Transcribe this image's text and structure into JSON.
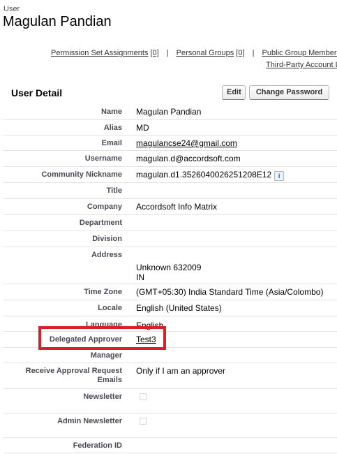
{
  "header": {
    "object_label": "User",
    "title": "Magulan Pandian"
  },
  "related_links": {
    "row1": [
      {
        "label": "Permission Set Assignments",
        "count": "[0]"
      },
      {
        "label": "Personal Groups",
        "count": "[0]"
      },
      {
        "label": "Public Group Membership",
        "count": ""
      }
    ],
    "row2": [
      {
        "label": "Third-Party Account L",
        "count": ""
      }
    ],
    "separator": "|"
  },
  "section": {
    "title": "User Detail",
    "edit_label": "Edit",
    "change_password_label": "Change Password"
  },
  "fields": [
    {
      "label": "Name",
      "value": "Magulan Pandian"
    },
    {
      "label": "Alias",
      "value": "MD"
    },
    {
      "label": "Email",
      "value": "magulancse24@gmail.com"
    },
    {
      "label": "Username",
      "value": "magulan.d@accordsoft.com"
    },
    {
      "label": "Community Nickname",
      "value": "magulan.d1.3526040026251208E12"
    },
    {
      "label": "Title",
      "value": ""
    },
    {
      "label": "Company",
      "value": "Accordsoft Info Matrix"
    },
    {
      "label": "Department",
      "value": ""
    },
    {
      "label": "Division",
      "value": ""
    },
    {
      "label": "Address",
      "value_line1": "Unknown 632009",
      "value_line2": "IN"
    },
    {
      "label": "Time Zone",
      "value": "(GMT+05:30) India Standard Time (Asia/Colombo)"
    },
    {
      "label": "Locale",
      "value": "English (United States)"
    },
    {
      "label": "Language",
      "value": "English"
    },
    {
      "label": "Delegated Approver",
      "value": "Test3"
    },
    {
      "label": "Manager",
      "value": ""
    },
    {
      "label": "Receive Approval Request Emails",
      "value": "Only if I am an approver"
    },
    {
      "label": "Newsletter",
      "checked": false
    },
    {
      "label": "Admin Newsletter",
      "checked": false
    },
    {
      "label": "Federation ID",
      "value": ""
    }
  ],
  "icons": {
    "info": "i"
  },
  "colors": {
    "highlight_border": "#d8202a",
    "label_text": "#4a4a56"
  }
}
